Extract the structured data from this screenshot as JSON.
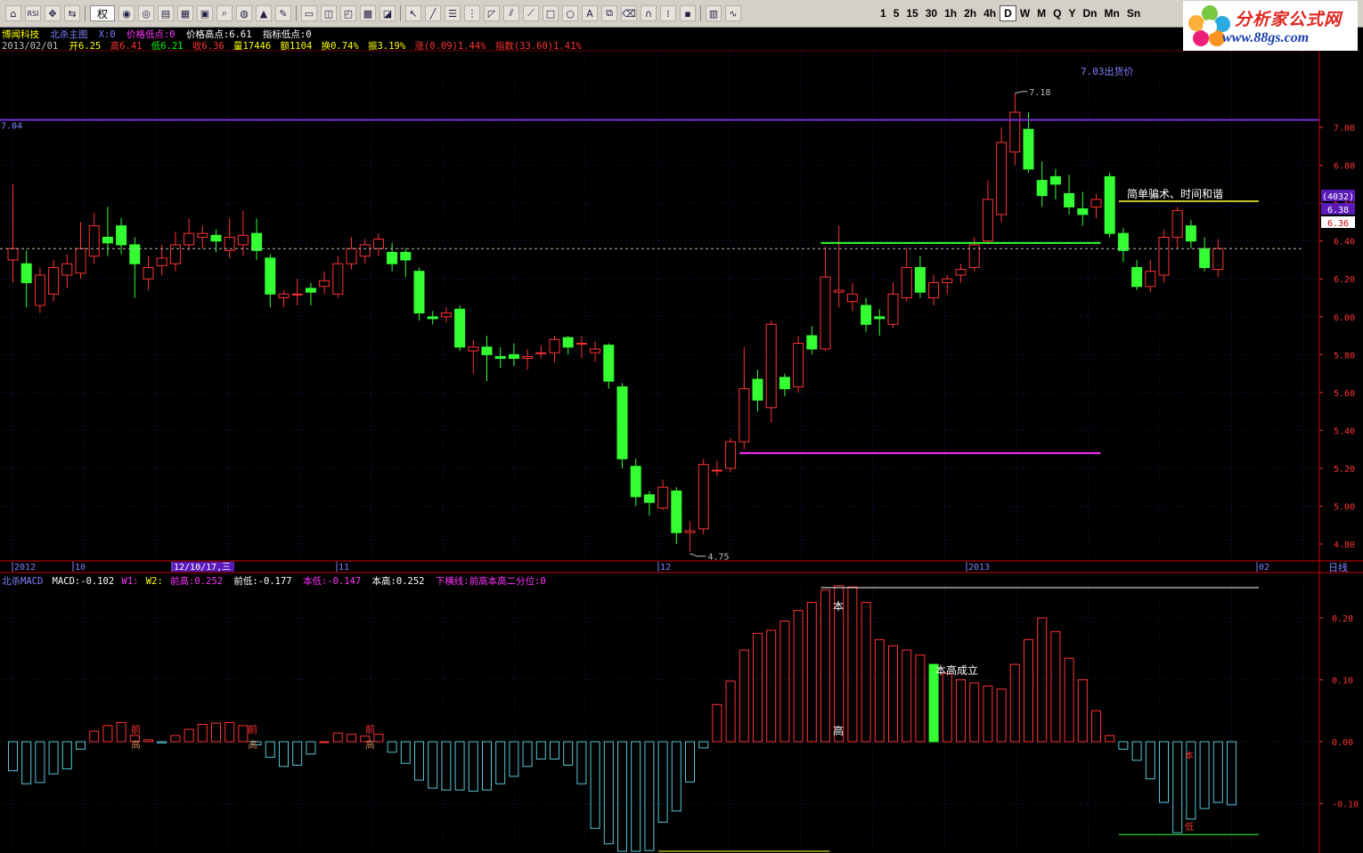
{
  "toolbar": {
    "quan_label": "权",
    "periods": [
      "1",
      "5",
      "15",
      "30",
      "1h",
      "2h",
      "4h",
      "D",
      "W",
      "M",
      "Q",
      "Y",
      "Dn",
      "Mn",
      "Sn"
    ],
    "active_period": "D"
  },
  "logo": {
    "title": "分析家公式网",
    "url": "www.88gs.com"
  },
  "header": {
    "stock_name": "博闻科技",
    "indicator_name": "北杀主图",
    "x_label": "X:0",
    "price_low_label": "价格低点:0",
    "price_high_label": "价格高点:6.61",
    "indicator_low_label": "指标低点:0"
  },
  "quote": {
    "date": "2013/02/01",
    "open": "开6.25",
    "high": "高6.41",
    "low": "低6.21",
    "close": "收6.36",
    "volume": "量17446",
    "amount": "额1104",
    "turnover": "换0.74%",
    "amplitude": "振3.19%",
    "change": "涨(0.09)1.44%",
    "index": "指数(33.60)1.41%"
  },
  "macd_header": {
    "name": "北杀MACD",
    "macd": "MACD:-0.102",
    "w1": "W1:",
    "w2": "W2:",
    "prev_high": "前高:0.252",
    "prev_low": "前低:-0.177",
    "this_low": "本低:-0.147",
    "this_high": "本高:0.252",
    "hline": "下横线:前高本高二分位:0"
  },
  "main_labels": {
    "left_price": "7.04",
    "high_mark": "7.18",
    "low_mark": "4.75",
    "sell_price": "7.03出货价",
    "trick_text": "简单骗术、时间和谐",
    "right_count": "(4032)",
    "right_price": "6.38",
    "current_price": "6.36"
  },
  "macd_labels": {
    "ben": "本",
    "gao": "高",
    "ben_gao_confirm": "本高成立",
    "qian": "前",
    "ben_small": "本",
    "di_small": "低"
  },
  "x_axis": {
    "labels": [
      "2012",
      "10",
      "12/10/17,三",
      "11",
      "12",
      "2013",
      "02"
    ],
    "period_label": "日线"
  },
  "chart_data": [
    {
      "type": "candlestick",
      "y_axis": {
        "ticks": [
          7.0,
          6.8,
          6.6,
          6.4,
          6.2,
          6.0,
          5.8,
          5.6,
          5.4,
          5.2,
          5.0,
          4.8
        ],
        "range": [
          4.72,
          7.4
        ]
      },
      "candles": [
        [
          6.3,
          6.36,
          6.7,
          6.18
        ],
        [
          6.28,
          6.18,
          6.35,
          6.05
        ],
        [
          6.06,
          6.22,
          6.26,
          6.02
        ],
        [
          6.12,
          6.26,
          6.3,
          6.08
        ],
        [
          6.22,
          6.28,
          6.33,
          6.15
        ],
        [
          6.23,
          6.36,
          6.5,
          6.2
        ],
        [
          6.32,
          6.48,
          6.55,
          6.28
        ],
        [
          6.42,
          6.39,
          6.58,
          6.32
        ],
        [
          6.48,
          6.38,
          6.52,
          6.33
        ],
        [
          6.38,
          6.28,
          6.42,
          6.1
        ],
        [
          6.2,
          6.26,
          6.32,
          6.14
        ],
        [
          6.27,
          6.31,
          6.38,
          6.22
        ],
        [
          6.28,
          6.38,
          6.45,
          6.24
        ],
        [
          6.38,
          6.44,
          6.52,
          6.35
        ],
        [
          6.42,
          6.44,
          6.48,
          6.36
        ],
        [
          6.43,
          6.4,
          6.46,
          6.34
        ],
        [
          6.35,
          6.42,
          6.52,
          6.31
        ],
        [
          6.38,
          6.43,
          6.56,
          6.32
        ],
        [
          6.44,
          6.35,
          6.52,
          6.3
        ],
        [
          6.31,
          6.12,
          6.33,
          6.05
        ],
        [
          6.1,
          6.12,
          6.14,
          6.05
        ],
        [
          6.12,
          6.12,
          6.2,
          6.06
        ],
        [
          6.15,
          6.13,
          6.18,
          6.06
        ],
        [
          6.16,
          6.19,
          6.24,
          6.12
        ],
        [
          6.12,
          6.28,
          6.32,
          6.1
        ],
        [
          6.28,
          6.36,
          6.42,
          6.25
        ],
        [
          6.32,
          6.38,
          6.41,
          6.28
        ],
        [
          6.36,
          6.41,
          6.44,
          6.32
        ],
        [
          6.34,
          6.28,
          6.39,
          6.24
        ],
        [
          6.34,
          6.3,
          6.36,
          6.21
        ],
        [
          6.24,
          6.02,
          6.26,
          5.98
        ],
        [
          6.0,
          5.99,
          6.03,
          5.96
        ],
        [
          6.0,
          6.02,
          6.05,
          5.97
        ],
        [
          6.04,
          5.84,
          6.06,
          5.82
        ],
        [
          5.82,
          5.84,
          5.88,
          5.7
        ],
        [
          5.84,
          5.8,
          5.9,
          5.66
        ],
        [
          5.79,
          5.78,
          5.84,
          5.73
        ],
        [
          5.8,
          5.78,
          5.86,
          5.74
        ],
        [
          5.78,
          5.79,
          5.83,
          5.72
        ],
        [
          5.81,
          5.81,
          5.85,
          5.78
        ],
        [
          5.81,
          5.88,
          5.9,
          5.76
        ],
        [
          5.89,
          5.84,
          5.9,
          5.8
        ],
        [
          5.86,
          5.86,
          5.9,
          5.78
        ],
        [
          5.81,
          5.83,
          5.87,
          5.76
        ],
        [
          5.85,
          5.66,
          5.86,
          5.62
        ],
        [
          5.63,
          5.25,
          5.65,
          5.2
        ],
        [
          5.21,
          5.05,
          5.25,
          5.0
        ],
        [
          5.06,
          5.02,
          5.08,
          4.95
        ],
        [
          4.99,
          5.1,
          5.14,
          4.98
        ],
        [
          5.08,
          4.86,
          5.1,
          4.8
        ],
        [
          4.86,
          4.87,
          4.92,
          4.76
        ],
        [
          4.88,
          5.22,
          5.25,
          4.85
        ],
        [
          5.19,
          5.19,
          5.24,
          5.16
        ],
        [
          5.2,
          5.34,
          5.36,
          5.18
        ],
        [
          5.34,
          5.62,
          5.84,
          5.3
        ],
        [
          5.67,
          5.56,
          5.72,
          5.5
        ],
        [
          5.52,
          5.96,
          5.98,
          5.44
        ],
        [
          5.68,
          5.62,
          5.7,
          5.58
        ],
        [
          5.63,
          5.86,
          5.9,
          5.6
        ],
        [
          5.9,
          5.83,
          5.95,
          5.8
        ],
        [
          5.83,
          6.21,
          6.37,
          5.82
        ],
        [
          6.13,
          6.14,
          6.48,
          6.05
        ],
        [
          6.08,
          6.12,
          6.18,
          6.03
        ],
        [
          6.06,
          5.96,
          6.1,
          5.92
        ],
        [
          6.0,
          5.99,
          6.04,
          5.9
        ],
        [
          5.96,
          6.12,
          6.18,
          5.94
        ],
        [
          6.1,
          6.26,
          6.36,
          6.08
        ],
        [
          6.26,
          6.13,
          6.32,
          6.1
        ],
        [
          6.1,
          6.18,
          6.22,
          6.06
        ],
        [
          6.18,
          6.2,
          6.22,
          6.12
        ],
        [
          6.22,
          6.25,
          6.28,
          6.18
        ],
        [
          6.26,
          6.38,
          6.42,
          6.24
        ],
        [
          6.4,
          6.62,
          6.72,
          6.38
        ],
        [
          6.54,
          6.92,
          7.0,
          6.5
        ],
        [
          6.87,
          7.08,
          7.18,
          6.8
        ],
        [
          6.99,
          6.78,
          7.08,
          6.76
        ],
        [
          6.72,
          6.64,
          6.82,
          6.58
        ],
        [
          6.74,
          6.7,
          6.78,
          6.62
        ],
        [
          6.65,
          6.58,
          6.75,
          6.54
        ],
        [
          6.57,
          6.54,
          6.66,
          6.48
        ],
        [
          6.58,
          6.62,
          6.65,
          6.52
        ],
        [
          6.74,
          6.44,
          6.76,
          6.42
        ],
        [
          6.44,
          6.35,
          6.47,
          6.29
        ],
        [
          6.26,
          6.16,
          6.3,
          6.14
        ],
        [
          6.16,
          6.24,
          6.3,
          6.13
        ],
        [
          6.22,
          6.42,
          6.46,
          6.18
        ],
        [
          6.42,
          6.56,
          6.58,
          6.36
        ],
        [
          6.48,
          6.4,
          6.51,
          6.36
        ],
        [
          6.36,
          6.26,
          6.42,
          6.24
        ],
        [
          6.25,
          6.36,
          6.41,
          6.21
        ]
      ]
    },
    {
      "type": "bar",
      "name": "MACD",
      "y_axis": {
        "ticks": [
          0.2,
          0.1,
          0.0,
          -0.1
        ],
        "range": [
          -0.177,
          0.26
        ]
      },
      "values": [
        -0.047,
        -0.068,
        -0.066,
        -0.052,
        -0.044,
        -0.012,
        0.017,
        0.026,
        0.031,
        0.01,
        0.003,
        -0.002,
        0.01,
        0.02,
        0.028,
        0.03,
        0.031,
        0.026,
        -0.005,
        -0.025,
        -0.04,
        -0.038,
        -0.02,
        0.0,
        0.014,
        0.012,
        0.009,
        0.012,
        -0.017,
        -0.035,
        -0.062,
        -0.075,
        -0.078,
        -0.078,
        -0.08,
        -0.078,
        -0.068,
        -0.056,
        -0.04,
        -0.028,
        -0.028,
        -0.038,
        -0.068,
        -0.14,
        -0.165,
        -0.177,
        -0.177,
        -0.176,
        -0.13,
        -0.112,
        -0.065,
        -0.01,
        0.06,
        0.098,
        0.148,
        0.175,
        0.18,
        0.195,
        0.212,
        0.225,
        0.245,
        0.252,
        0.25,
        0.225,
        0.165,
        0.155,
        0.148,
        0.14,
        0.125,
        0.11,
        0.1,
        0.095,
        0.09,
        0.085,
        0.125,
        0.165,
        0.2,
        0.178,
        0.135,
        0.1,
        0.05,
        0.01,
        -0.012,
        -0.03,
        -0.06,
        -0.098,
        -0.147,
        -0.125,
        -0.108,
        -0.098,
        -0.102
      ]
    }
  ]
}
